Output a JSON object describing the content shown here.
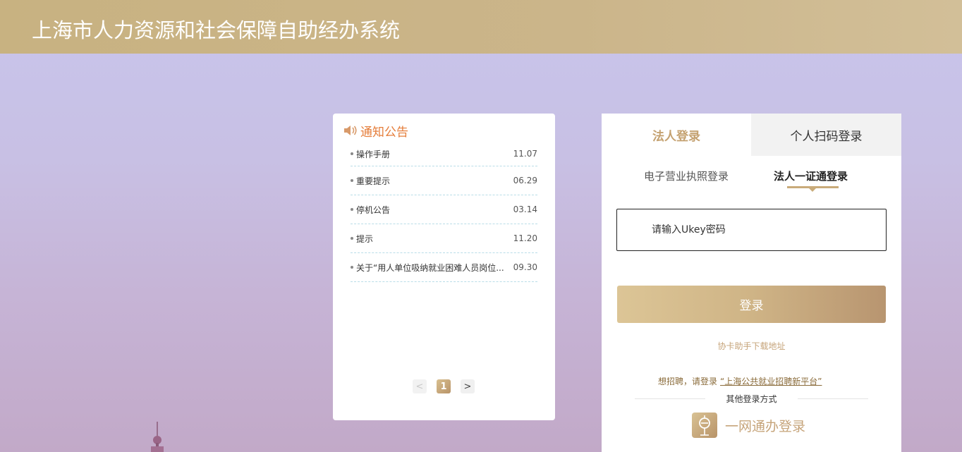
{
  "header": {
    "title": "上海市人力资源和社会保障自助经办系统"
  },
  "notice": {
    "title": "通知公告",
    "items": [
      {
        "text": "操作手册",
        "date": "11.07"
      },
      {
        "text": "重要提示",
        "date": "06.29"
      },
      {
        "text": "停机公告",
        "date": "03.14"
      },
      {
        "text": "提示",
        "date": "11.20"
      },
      {
        "text": "关于“用人单位吸纳就业困难人员岗位...",
        "date": "09.30"
      }
    ],
    "pager": {
      "prev": "<",
      "current": "1",
      "next": ">"
    }
  },
  "login": {
    "tabs": [
      {
        "label": "法人登录",
        "active": true
      },
      {
        "label": "个人扫码登录",
        "active": false
      }
    ],
    "subtabs": [
      {
        "label": "电子营业执照登录",
        "active": false
      },
      {
        "label": "法人一证通登录",
        "active": true
      }
    ],
    "ukey_placeholder": "请输入Ukey密码",
    "login_button": "登录",
    "helper_link": "协卡助手下载地址",
    "recruit_prefix": "想招聘，请登录",
    "recruit_link": "“上海公共就业招聘新平台”",
    "other_methods": "其他登录方式",
    "yiwang_label": "一网通办登录"
  },
  "colors": {
    "header_gold": "#c8b281",
    "notice_orange": "#e57d3a",
    "accent_gold": "#c4a170"
  }
}
